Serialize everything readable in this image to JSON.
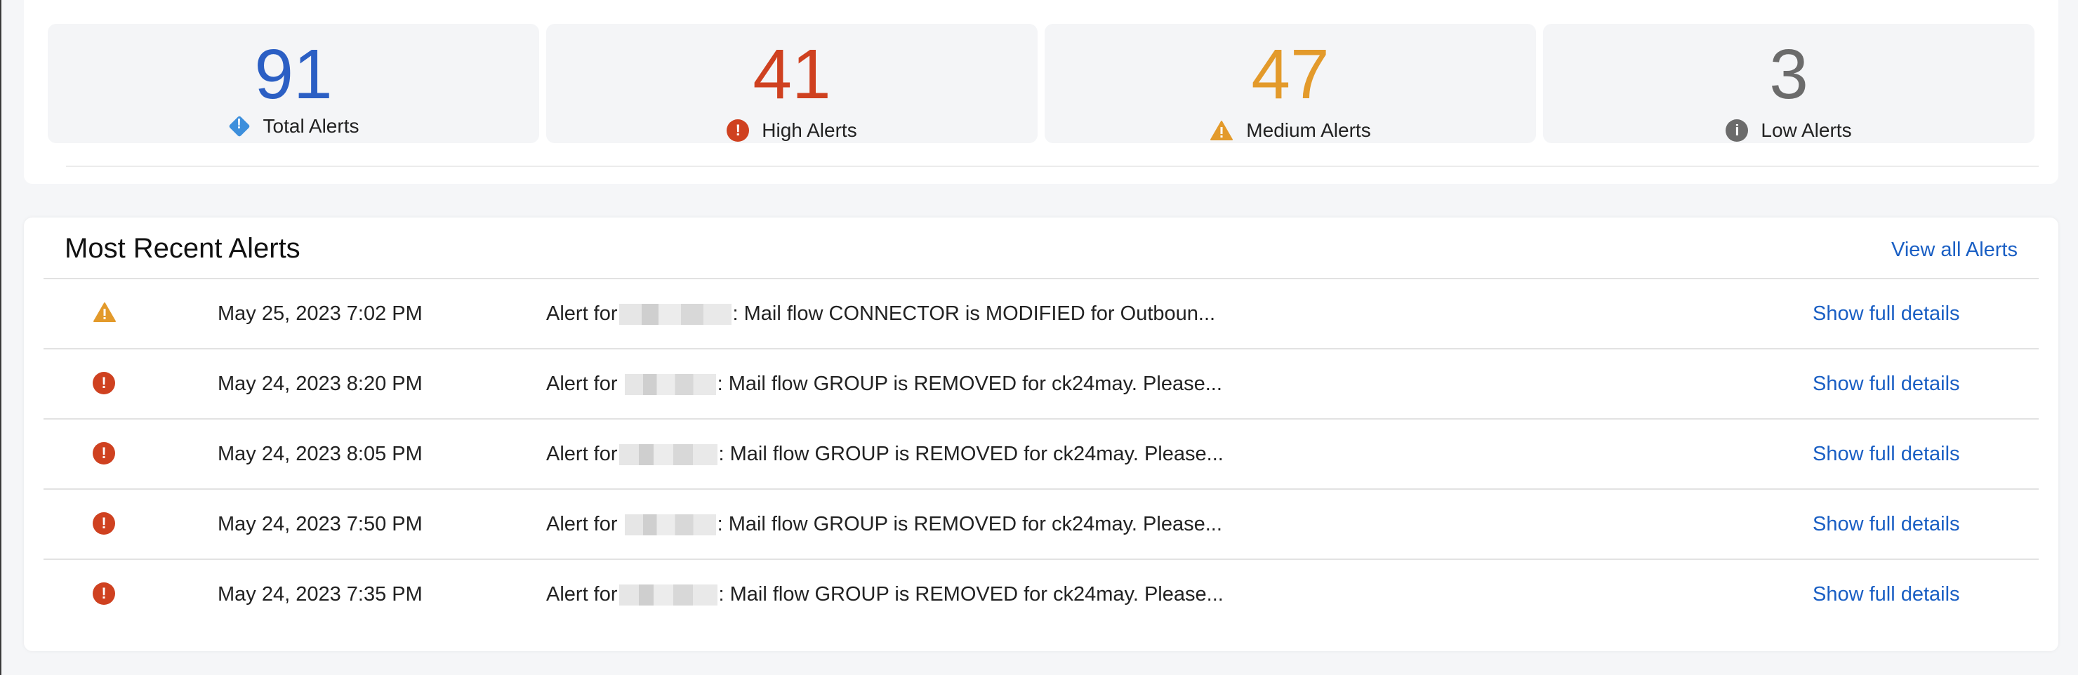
{
  "summary": {
    "total": {
      "value": "91",
      "label": "Total Alerts",
      "icon": "info-diamond-icon",
      "color": "#2b5fc4"
    },
    "high": {
      "value": "41",
      "label": "High Alerts",
      "icon": "error-circle-icon",
      "color": "#cf4120"
    },
    "medium": {
      "value": "47",
      "label": "Medium Alerts",
      "icon": "warning-triangle-icon",
      "color": "#e39a2b"
    },
    "low": {
      "value": "3",
      "label": "Low Alerts",
      "icon": "info-circle-icon",
      "color": "#6b6b6b"
    }
  },
  "recent": {
    "title": "Most Recent Alerts",
    "view_all_label": "View all Alerts",
    "rows": [
      {
        "severity": "medium",
        "date": "May 25, 2023 7:02 PM",
        "prefix": "Alert for",
        "message": ": Mail flow CONNECTOR is MODIFIED for Outboun...",
        "action": "Show full details"
      },
      {
        "severity": "high",
        "date": "May 24, 2023 8:20 PM",
        "prefix": "Alert for",
        "message": ": Mail flow GROUP is REMOVED for ck24may. Please...",
        "action": "Show full details"
      },
      {
        "severity": "high",
        "date": "May 24, 2023 8:05 PM",
        "prefix": "Alert for",
        "message": ": Mail flow GROUP is REMOVED for ck24may. Please...",
        "action": "Show full details"
      },
      {
        "severity": "high",
        "date": "May 24, 2023 7:50 PM",
        "prefix": "Alert for",
        "message": ": Mail flow GROUP is REMOVED for ck24may. Please...",
        "action": "Show full details"
      },
      {
        "severity": "high",
        "date": "May 24, 2023 7:35 PM",
        "prefix": "Alert for",
        "message": ": Mail flow GROUP is REMOVED for ck24may. Please...",
        "action": "Show full details"
      }
    ]
  }
}
